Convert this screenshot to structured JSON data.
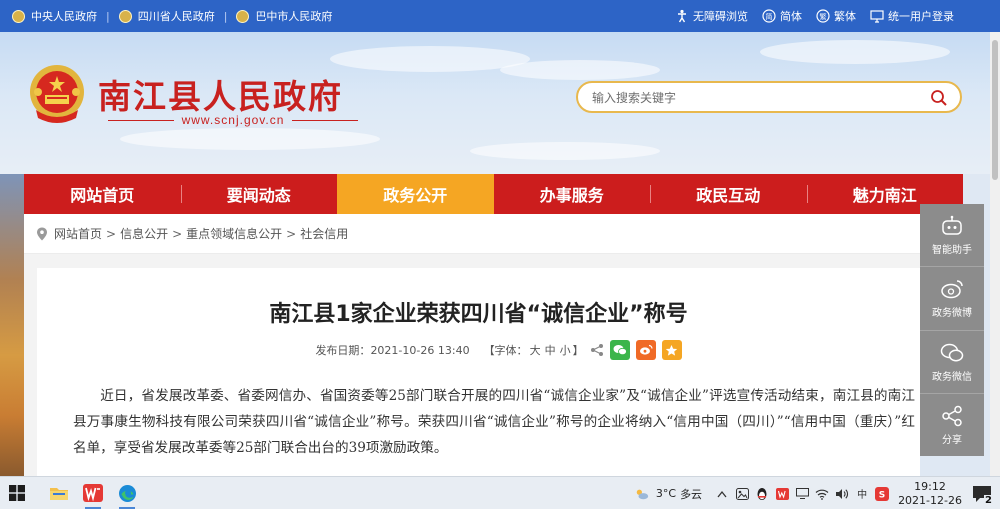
{
  "topbar": {
    "links": [
      "中央人民政府",
      "四川省人民政府",
      "巴中市人民政府"
    ],
    "separator": "|",
    "tools": {
      "accessible": "无障碍浏览",
      "simplified": "简体",
      "traditional": "繁体",
      "login": "统一用户登录"
    }
  },
  "header": {
    "site_name": "南江县人民政府",
    "domain": "www.scnj.gov.cn",
    "search_placeholder": "输入搜索关键字"
  },
  "nav": {
    "items": [
      "网站首页",
      "要闻动态",
      "政务公开",
      "办事服务",
      "政民互动",
      "魅力南江"
    ],
    "active": "政务公开"
  },
  "breadcrumb": {
    "items": [
      "网站首页",
      "信息公开",
      "重点领域信息公开",
      "社会信用"
    ],
    "separator": ">"
  },
  "article": {
    "title": "南江县1家企业荣获四川省“诚信企业”称号",
    "date_label": "发布日期：",
    "date": "2021-10-26 13:40",
    "font_label": "【字体：",
    "font_large": "大",
    "font_medium": "中",
    "font_small": "小",
    "font_close": "】",
    "paragraph": "近日，省发展改革委、省委网信办、省国资委等25部门联合开展的四川省“诚信企业家”及“诚信企业”评选宣传活动结束，南江县的南江县万事康生物科技有限公司荣获四川省“诚信企业”称号。荣获四川省“诚信企业”称号的企业将纳入“信用中国（四川）”“信用中国（重庆）”红名单，享受省发展改革委等25部门联合出台的39项激励政策。"
  },
  "floatbar": {
    "items": [
      "智能助手",
      "政务微博",
      "政务微信",
      "分享"
    ]
  },
  "taskbar": {
    "weather_temp": "3°C",
    "weather_desc": "多云",
    "ime": "中",
    "time": "19:12",
    "date": "2021-12-26",
    "notifications": "2"
  },
  "colors": {
    "topbar": "#2d64c6",
    "brand_red": "#cc1d1d",
    "nav_active": "#f5a623",
    "search_border": "#e8b84d",
    "floatbar": "#8c8c8c"
  }
}
